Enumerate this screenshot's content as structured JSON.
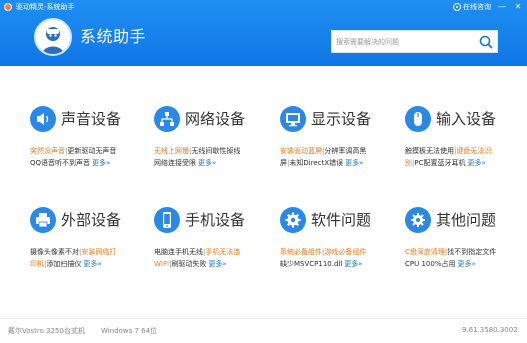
{
  "window": {
    "title": "驱动精灵-系统助手",
    "help_label": "在线咨询",
    "minimize_glyph": "—",
    "close_glyph": "✕"
  },
  "header": {
    "app_name": "系统助手",
    "search_placeholder": "搜索需要解决的问题"
  },
  "colors": {
    "header_blue": "#1380ea",
    "icon_blue": "#2a88e6",
    "orange_link": "#f07a1c",
    "more_link": "#1a78d8"
  },
  "categories": [
    {
      "title": "声音设备",
      "icon": "speaker-icon",
      "line1": [
        {
          "text": "突然没声音",
          "style": "orange"
        },
        {
          "text": "|",
          "style": "sep"
        },
        {
          "text": "更新驱动无声音",
          "style": "dark"
        }
      ],
      "line2": [
        {
          "text": "QQ语音听不到声音",
          "style": "dark"
        }
      ],
      "more": "更多»"
    },
    {
      "title": "网络设备",
      "icon": "network-icon",
      "line1": [
        {
          "text": "无线上网慢",
          "style": "orange"
        },
        {
          "text": "|",
          "style": "sep"
        },
        {
          "text": "无线间歇性掉线",
          "style": "dark"
        }
      ],
      "line2": [
        {
          "text": "网络连接受限",
          "style": "dark"
        }
      ],
      "more": "更多»"
    },
    {
      "title": "显示设备",
      "icon": "monitor-icon",
      "line1": [
        {
          "text": "安装驱动蓝屏",
          "style": "orange"
        },
        {
          "text": "|",
          "style": "sep"
        },
        {
          "text": "分辨率调高黑",
          "style": "dark"
        }
      ],
      "line2": [
        {
          "text": "屏",
          "style": "dark"
        },
        {
          "text": "|",
          "style": "sep"
        },
        {
          "text": "未知DirectX错误",
          "style": "dark"
        }
      ],
      "more": "更多»"
    },
    {
      "title": "输入设备",
      "icon": "mouse-icon",
      "line1": [
        {
          "text": "触摸板无法使用",
          "style": "dark"
        },
        {
          "text": "|",
          "style": "sep"
        },
        {
          "text": "键盘无法识",
          "style": "orange"
        }
      ],
      "line2": [
        {
          "text": "别",
          "style": "orange"
        },
        {
          "text": "|",
          "style": "sep"
        },
        {
          "text": "PC配置蓝牙耳机",
          "style": "dark"
        }
      ],
      "more": "更多»"
    },
    {
      "title": "外部设备",
      "icon": "printer-icon",
      "line1": [
        {
          "text": "摄像头像素不对",
          "style": "dark"
        },
        {
          "text": "|",
          "style": "sep"
        },
        {
          "text": "安装网络打",
          "style": "orange"
        }
      ],
      "line2": [
        {
          "text": "印机",
          "style": "orange"
        },
        {
          "text": "|",
          "style": "sep"
        },
        {
          "text": "添加扫描仪",
          "style": "dark"
        }
      ],
      "more": "更多»"
    },
    {
      "title": "手机设备",
      "icon": "phone-icon",
      "line1": [
        {
          "text": "电脑连手机无线",
          "style": "dark"
        },
        {
          "text": "|",
          "style": "sep"
        },
        {
          "text": "手机无法连",
          "style": "orange"
        }
      ],
      "line2": [
        {
          "text": "WIFI",
          "style": "orange"
        },
        {
          "text": "|",
          "style": "sep"
        },
        {
          "text": "刷驱动失败",
          "style": "dark"
        }
      ],
      "more": "更多»"
    },
    {
      "title": "软件问题",
      "icon": "gear-icon",
      "line1": [
        {
          "text": "系统必备组件",
          "style": "orange"
        },
        {
          "text": "|",
          "style": "sep"
        },
        {
          "text": "游戏必备组件",
          "style": "orange"
        }
      ],
      "line2": [
        {
          "text": "缺少MSVCP110.dll",
          "style": "dark"
        }
      ],
      "more": "更多»"
    },
    {
      "title": "其他问题",
      "icon": "settings-icon",
      "line1": [
        {
          "text": "C盘深度清理",
          "style": "orange"
        },
        {
          "text": "|",
          "style": "sep"
        },
        {
          "text": "找不到指定文件",
          "style": "dark"
        }
      ],
      "line2": [
        {
          "text": "CPU 100%占用",
          "style": "dark"
        }
      ],
      "more": "更多»"
    }
  ],
  "footer": {
    "model": "戴尔Vostro 3250台式机",
    "os": "Windows 7 64位",
    "version": "9.61.3580.3002"
  }
}
